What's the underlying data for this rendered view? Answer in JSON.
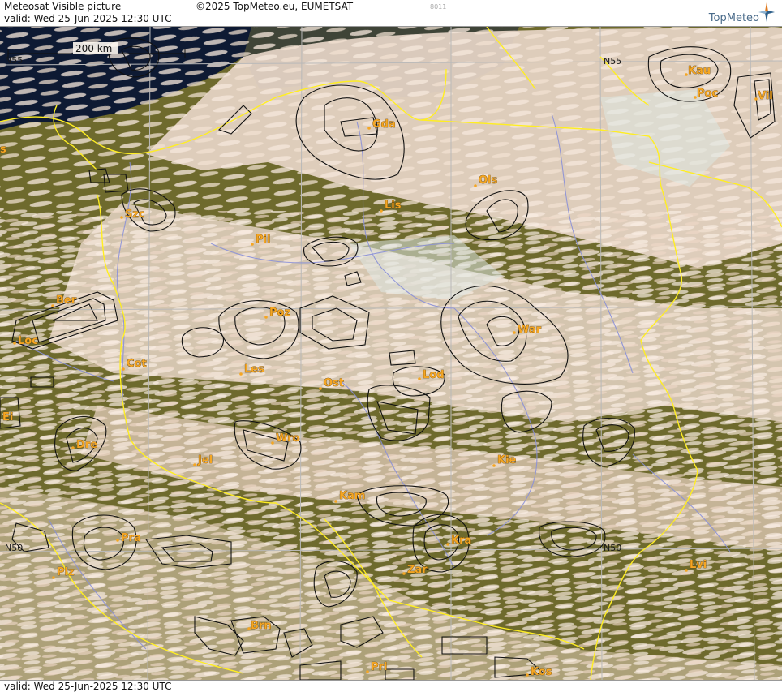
{
  "header": {
    "title": "Meteosat Visible picture",
    "copyright": "©2025 TopMeteo.eu, EUMETSAT",
    "valid": "valid:  Wed  25-Jun-2025  12:30 UTC",
    "code": "8011",
    "brand": "TopMeteo"
  },
  "footer": {
    "valid": "valid:  Wed  25-Jun-2025  12:30 UTC"
  },
  "scale_bar": {
    "label": "200 km"
  },
  "grid_labels": {
    "n55_left": "N55",
    "n55_right": "N55",
    "n50_left": "N50",
    "n50_right": "N50"
  },
  "cities": [
    "Gda",
    "Kau",
    "Poc",
    "Vil",
    "Ols",
    "Lis",
    "Szc",
    "Pil",
    "Ber",
    "Poz",
    "War",
    "Loc",
    "Cot",
    "Les",
    "Ost",
    "Lod",
    "Ei",
    "Dre",
    "Wro",
    "Jel",
    "Kie",
    "Kam",
    "Pra",
    "Kra",
    "Plz",
    "Zar",
    "Lvi",
    "Brn",
    "Pri",
    "Kos",
    "s"
  ],
  "colors": {
    "border": "#ffee22",
    "river": "#8a90d8",
    "sea": "#0e1a33",
    "cloud": "#f2e2d6",
    "land": "#6f6a2c",
    "grid": "#b9b9b9",
    "city": "#f5a623"
  }
}
